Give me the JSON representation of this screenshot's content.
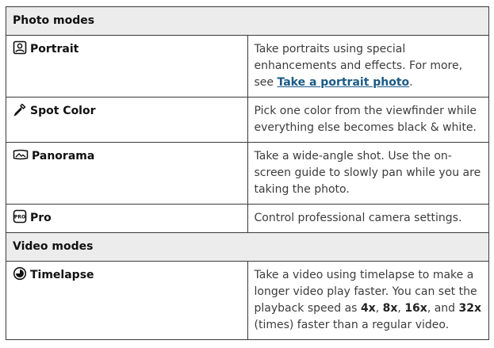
{
  "sections": {
    "photo": {
      "title": "Photo modes",
      "rows": [
        {
          "name": "Portrait",
          "icon": "portrait-icon",
          "desc_before": "Take portraits using special enhancements and effects. For more, see ",
          "link": "Take a portrait photo",
          "desc_after": "."
        },
        {
          "name": "Spot Color",
          "icon": "eyedropper-icon",
          "desc": "Pick one color from the viewfinder while everything else becomes black & white."
        },
        {
          "name": "Panorama",
          "icon": "panorama-icon",
          "desc": "Take a wide-angle shot. Use the on-screen guide to slowly pan while you are taking the photo."
        },
        {
          "name": "Pro",
          "icon": "pro-icon",
          "icon_text": "PRO",
          "desc": "Control professional camera settings."
        }
      ]
    },
    "video": {
      "title": "Video modes",
      "rows": [
        {
          "name": "Timelapse",
          "icon": "timelapse-icon",
          "desc_1": "Take a video using timelapse to make a longer video play faster. You can set the playback speed as ",
          "speed_1": "4x",
          "sep_1": ", ",
          "speed_2": "8x",
          "sep_2": ", ",
          "speed_3": "16x",
          "sep_3": ", and ",
          "speed_4": "32x",
          "desc_2": " (times) faster than a regular video."
        }
      ]
    }
  }
}
